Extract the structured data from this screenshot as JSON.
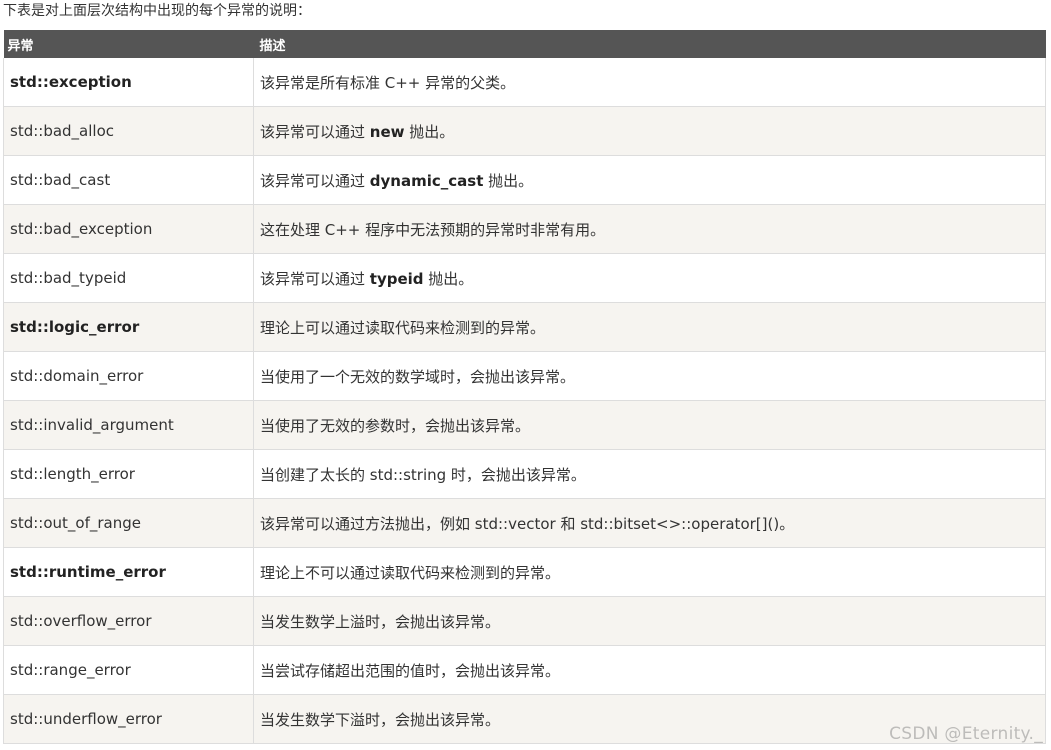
{
  "intro": "下表是对上面层次结构中出现的每个异常的说明：",
  "table": {
    "headers": [
      "异常",
      "描述"
    ],
    "rows": [
      {
        "name": "std::exception",
        "name_bold": true,
        "desc": [
          {
            "t": "该异常是所有标准 C++ 异常的父类。",
            "b": false
          }
        ]
      },
      {
        "name": "std::bad_alloc",
        "name_bold": false,
        "desc": [
          {
            "t": "该异常可以通过 ",
            "b": false
          },
          {
            "t": "new",
            "b": true
          },
          {
            "t": " 抛出。",
            "b": false
          }
        ]
      },
      {
        "name": "std::bad_cast",
        "name_bold": false,
        "desc": [
          {
            "t": "该异常可以通过 ",
            "b": false
          },
          {
            "t": "dynamic_cast",
            "b": true
          },
          {
            "t": " 抛出。",
            "b": false
          }
        ]
      },
      {
        "name": "std::bad_exception",
        "name_bold": false,
        "desc": [
          {
            "t": "这在处理 C++ 程序中无法预期的异常时非常有用。",
            "b": false
          }
        ]
      },
      {
        "name": "std::bad_typeid",
        "name_bold": false,
        "desc": [
          {
            "t": "该异常可以通过 ",
            "b": false
          },
          {
            "t": "typeid",
            "b": true
          },
          {
            "t": " 抛出。",
            "b": false
          }
        ]
      },
      {
        "name": "std::logic_error",
        "name_bold": true,
        "desc": [
          {
            "t": "理论上可以通过读取代码来检测到的异常。",
            "b": false
          }
        ]
      },
      {
        "name": "std::domain_error",
        "name_bold": false,
        "desc": [
          {
            "t": "当使用了一个无效的数学域时，会抛出该异常。",
            "b": false
          }
        ]
      },
      {
        "name": "std::invalid_argument",
        "name_bold": false,
        "desc": [
          {
            "t": "当使用了无效的参数时，会抛出该异常。",
            "b": false
          }
        ]
      },
      {
        "name": "std::length_error",
        "name_bold": false,
        "desc": [
          {
            "t": "当创建了太长的 std::string 时，会抛出该异常。",
            "b": false
          }
        ]
      },
      {
        "name": "std::out_of_range",
        "name_bold": false,
        "desc": [
          {
            "t": "该异常可以通过方法抛出，例如 std::vector 和 std::bitset<>::operator[]()。",
            "b": false
          }
        ]
      },
      {
        "name": "std::runtime_error",
        "name_bold": true,
        "desc": [
          {
            "t": "理论上不可以通过读取代码来检测到的异常。",
            "b": false
          }
        ]
      },
      {
        "name": "std::overflow_error",
        "name_bold": false,
        "desc": [
          {
            "t": "当发生数学上溢时，会抛出该异常。",
            "b": false
          }
        ]
      },
      {
        "name": "std::range_error",
        "name_bold": false,
        "desc": [
          {
            "t": "当尝试存储超出范围的值时，会抛出该异常。",
            "b": false
          }
        ]
      },
      {
        "name": "std::underflow_error",
        "name_bold": false,
        "desc": [
          {
            "t": "当发生数学下溢时，会抛出该异常。",
            "b": false
          }
        ]
      }
    ]
  },
  "watermark": "CSDN @Eternity._"
}
